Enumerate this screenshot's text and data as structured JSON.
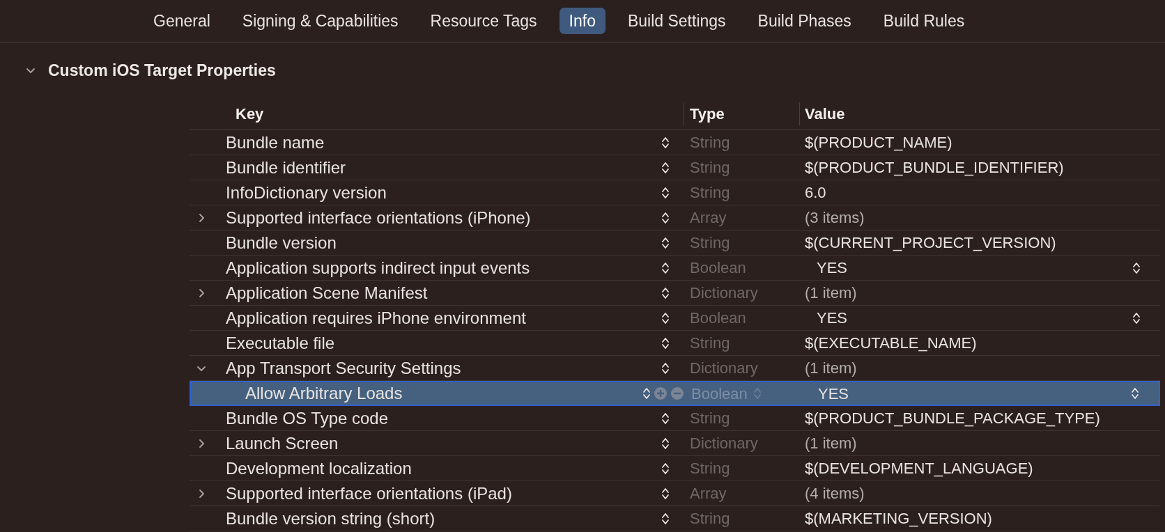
{
  "tabs": [
    {
      "label": "General",
      "selected": false
    },
    {
      "label": "Signing & Capabilities",
      "selected": false
    },
    {
      "label": "Resource Tags",
      "selected": false
    },
    {
      "label": "Info",
      "selected": true
    },
    {
      "label": "Build Settings",
      "selected": false
    },
    {
      "label": "Build Phases",
      "selected": false
    },
    {
      "label": "Build Rules",
      "selected": false
    }
  ],
  "section": {
    "title": "Custom iOS Target Properties",
    "expanded": true
  },
  "table": {
    "columns": [
      "Key",
      "Type",
      "Value"
    ],
    "rows": [
      {
        "key": "Bundle name",
        "type": "String",
        "value": "$(PRODUCT_NAME)",
        "kind": "text",
        "expandable": false,
        "selected": false
      },
      {
        "key": "Bundle identifier",
        "type": "String",
        "value": "$(PRODUCT_BUNDLE_IDENTIFIER)",
        "kind": "text",
        "expandable": false,
        "selected": false
      },
      {
        "key": "InfoDictionary version",
        "type": "String",
        "value": "6.0",
        "kind": "text",
        "expandable": false,
        "selected": false
      },
      {
        "key": "Supported interface orientations (iPhone)",
        "type": "Array",
        "value": "(3 items)",
        "kind": "count",
        "expandable": true,
        "expanded": false,
        "selected": false
      },
      {
        "key": "Bundle version",
        "type": "String",
        "value": "$(CURRENT_PROJECT_VERSION)",
        "kind": "text",
        "expandable": false,
        "selected": false
      },
      {
        "key": "Application supports indirect input events",
        "type": "Boolean",
        "value": "YES",
        "kind": "boolean",
        "expandable": false,
        "selected": false
      },
      {
        "key": "Application Scene Manifest",
        "type": "Dictionary",
        "value": "(1 item)",
        "kind": "count",
        "expandable": true,
        "expanded": false,
        "selected": false
      },
      {
        "key": "Application requires iPhone environment",
        "type": "Boolean",
        "value": "YES",
        "kind": "boolean",
        "expandable": false,
        "selected": false
      },
      {
        "key": "Executable file",
        "type": "String",
        "value": "$(EXECUTABLE_NAME)",
        "kind": "text",
        "expandable": false,
        "selected": false
      },
      {
        "key": "App Transport Security Settings",
        "type": "Dictionary",
        "value": "(1 item)",
        "kind": "count",
        "expandable": true,
        "expanded": true,
        "selected": false,
        "children": [
          {
            "key": "Allow Arbitrary Loads",
            "type": "Boolean",
            "value": "YES",
            "kind": "boolean",
            "expandable": false,
            "selected": true
          }
        ]
      },
      {
        "key": "Bundle OS Type code",
        "type": "String",
        "value": "$(PRODUCT_BUNDLE_PACKAGE_TYPE)",
        "kind": "text",
        "expandable": false,
        "selected": false
      },
      {
        "key": "Launch Screen",
        "type": "Dictionary",
        "value": "(1 item)",
        "kind": "count",
        "expandable": true,
        "expanded": false,
        "selected": false
      },
      {
        "key": "Development localization",
        "type": "String",
        "value": "$(DEVELOPMENT_LANGUAGE)",
        "kind": "text",
        "expandable": false,
        "selected": false
      },
      {
        "key": "Supported interface orientations (iPad)",
        "type": "Array",
        "value": "(4 items)",
        "kind": "count",
        "expandable": true,
        "expanded": false,
        "selected": false
      },
      {
        "key": "Bundle version string (short)",
        "type": "String",
        "value": "$(MARKETING_VERSION)",
        "kind": "text",
        "expandable": false,
        "selected": false
      }
    ]
  }
}
